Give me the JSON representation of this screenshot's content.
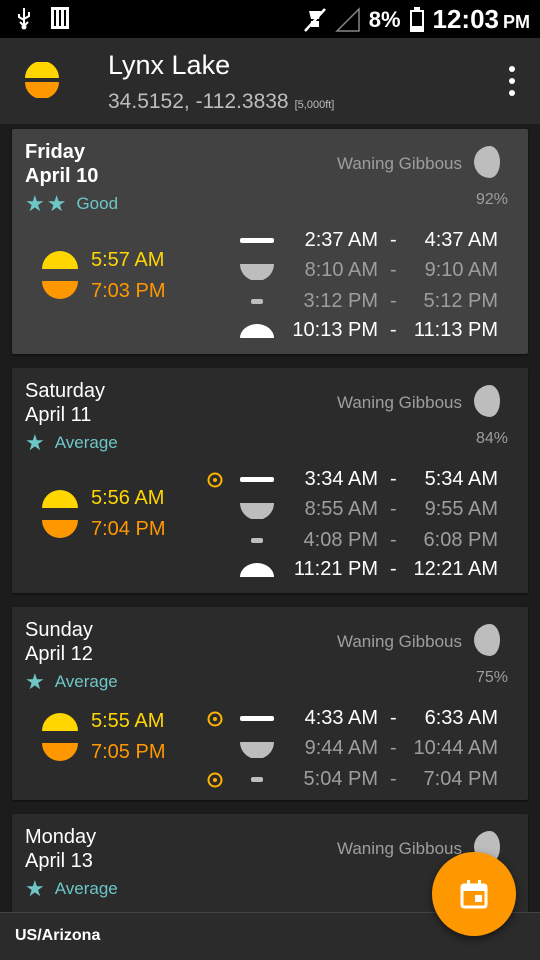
{
  "status_bar": {
    "battery_percent": "8%",
    "time": "12:03",
    "ampm": "PM"
  },
  "app_bar": {
    "title": "Lynx Lake",
    "coordinates": "34.5152, -112.3838",
    "elevation": "[5,000ft]"
  },
  "colors": {
    "sunrise": "#ffd600",
    "sunset": "#ff9800",
    "rating": "#6ec6c6",
    "fab": "#ff9800"
  },
  "days": [
    {
      "name": "Friday",
      "date": "April 10",
      "stars": "★★",
      "rating": "Good",
      "phase": "Waning Gibbous",
      "illumination": "92%",
      "sunrise": "5:57 AM",
      "sunset": "7:03 PM",
      "periods": [
        {
          "type": "major",
          "start": "2:37 AM",
          "end": "4:37 AM"
        },
        {
          "type": "minor",
          "start": "8:10 AM",
          "end": "9:10 AM"
        },
        {
          "type": "minor",
          "start": "3:12 PM",
          "end": "5:12 PM"
        },
        {
          "type": "major",
          "start": "10:13 PM",
          "end": "11:13 PM"
        }
      ]
    },
    {
      "name": "Saturday",
      "date": "April 11",
      "stars": "★",
      "rating": "Average",
      "phase": "Waning Gibbous",
      "illumination": "84%",
      "sunrise": "5:56 AM",
      "sunset": "7:04 PM",
      "periods": [
        {
          "type": "major",
          "start": "3:34 AM",
          "end": "5:34 AM"
        },
        {
          "type": "minor",
          "start": "8:55 AM",
          "end": "9:55 AM"
        },
        {
          "type": "minor",
          "start": "4:08 PM",
          "end": "6:08 PM"
        },
        {
          "type": "major",
          "start": "11:21 PM",
          "end": "12:21 AM"
        }
      ]
    },
    {
      "name": "Sunday",
      "date": "April 12",
      "stars": "★",
      "rating": "Average",
      "phase": "Waning Gibbous",
      "illumination": "75%",
      "sunrise": "5:55 AM",
      "sunset": "7:05 PM",
      "periods": [
        {
          "type": "major",
          "start": "4:33 AM",
          "end": "6:33 AM"
        },
        {
          "type": "minor",
          "start": "9:44 AM",
          "end": "10:44 AM"
        },
        {
          "type": "minor",
          "start": "5:04 PM",
          "end": "7:04 PM"
        }
      ]
    },
    {
      "name": "Monday",
      "date": "April 13",
      "stars": "★",
      "rating": "Average",
      "phase": "Waning Gibbous"
    }
  ],
  "dash": "-",
  "timezone": "US/Arizona",
  "fab": {
    "icon": "calendar-icon"
  }
}
